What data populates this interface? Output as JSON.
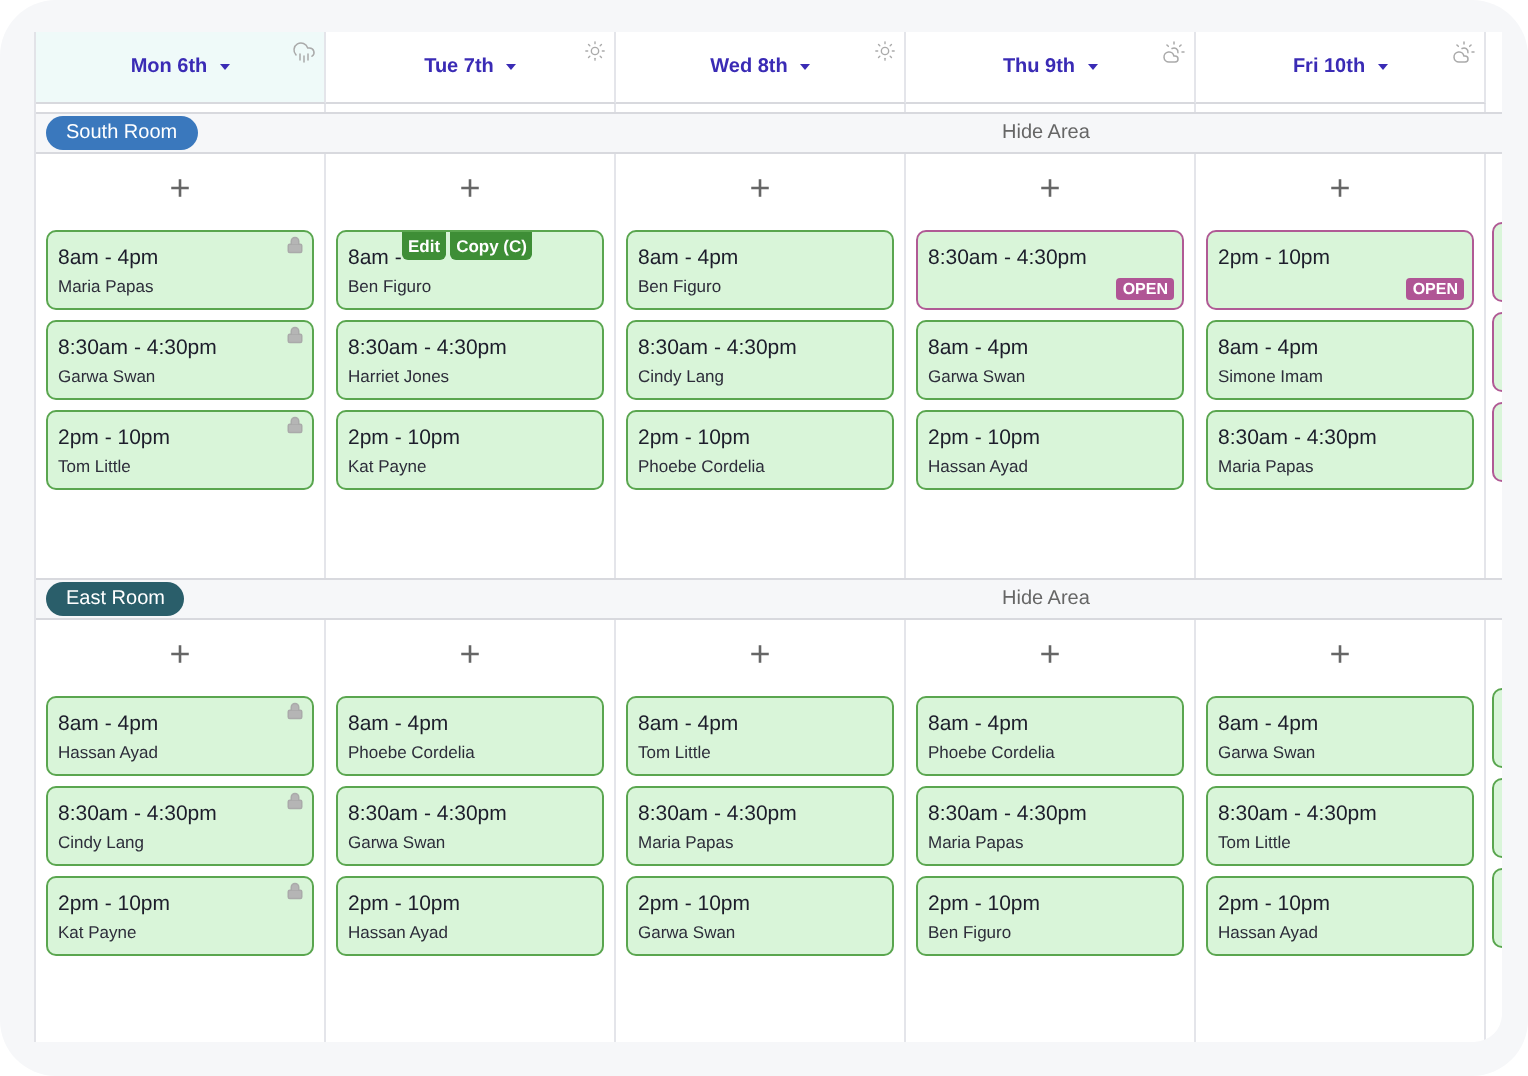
{
  "days": [
    {
      "label": "Mon 6th",
      "selected": true,
      "kind": "rain"
    },
    {
      "label": "Tue 7th",
      "selected": false,
      "kind": "sun"
    },
    {
      "label": "Wed 8th",
      "selected": false,
      "kind": "sun"
    },
    {
      "label": "Thu 9th",
      "selected": false,
      "kind": "partly-cloudy"
    },
    {
      "label": "Fri 10th",
      "selected": false,
      "kind": "partly-cloudy"
    }
  ],
  "rooms": [
    {
      "name": "South Room",
      "color": "#3a78bd",
      "hide_label": "Hide Area",
      "add_label": "+",
      "columns": [
        [
          {
            "time": "8am - 4pm",
            "person": "Maria Papas",
            "locked": true,
            "open": false
          },
          {
            "time": "8:30am - 4:30pm",
            "person": "Garwa Swan",
            "locked": true,
            "open": false
          },
          {
            "time": "2pm - 10pm",
            "person": "Tom Little",
            "locked": true,
            "open": false
          }
        ],
        [
          {
            "time": "8am -",
            "person": "Ben Figuro",
            "locked": false,
            "open": false,
            "actions": [
              "Edit",
              "Copy (C)"
            ]
          },
          {
            "time": "8:30am - 4:30pm",
            "person": "Harriet Jones",
            "locked": false,
            "open": false
          },
          {
            "time": "2pm - 10pm",
            "person": "Kat Payne",
            "locked": false,
            "open": false
          }
        ],
        [
          {
            "time": "8am - 4pm",
            "person": "Ben Figuro",
            "locked": false,
            "open": false
          },
          {
            "time": "8:30am - 4:30pm",
            "person": "Cindy Lang",
            "locked": false,
            "open": false
          },
          {
            "time": "2pm - 10pm",
            "person": "Phoebe Cordelia",
            "locked": false,
            "open": false
          }
        ],
        [
          {
            "time": "8:30am - 4:30pm",
            "locked": false,
            "open": true,
            "badge": "OPEN"
          },
          {
            "time": "8am - 4pm",
            "person": "Garwa Swan",
            "locked": false,
            "open": false
          },
          {
            "time": "2pm - 10pm",
            "person": "Hassan Ayad",
            "locked": false,
            "open": false
          }
        ],
        [
          {
            "time": "2pm - 10pm",
            "locked": false,
            "open": true,
            "badge": "OPEN"
          },
          {
            "time": "8am - 4pm",
            "person": "Simone Imam",
            "locked": false,
            "open": false
          },
          {
            "time": "8:30am - 4:30pm",
            "person": "Maria Papas",
            "locked": false,
            "open": false
          }
        ]
      ],
      "cut_column": [
        {
          "open": true
        },
        {
          "open": true
        },
        {
          "open": true
        }
      ]
    },
    {
      "name": "East Room",
      "color": "#2a5e6a",
      "hide_label": "Hide Area",
      "add_label": "+",
      "columns": [
        [
          {
            "time": "8am - 4pm",
            "person": "Hassan Ayad",
            "locked": true,
            "open": false
          },
          {
            "time": "8:30am - 4:30pm",
            "person": "Cindy Lang",
            "locked": true,
            "open": false
          },
          {
            "time": "2pm - 10pm",
            "person": "Kat Payne",
            "locked": true,
            "open": false
          }
        ],
        [
          {
            "time": "8am - 4pm",
            "person": "Phoebe Cordelia",
            "locked": false,
            "open": false
          },
          {
            "time": "8:30am - 4:30pm",
            "person": "Garwa Swan",
            "locked": false,
            "open": false
          },
          {
            "time": "2pm - 10pm",
            "person": "Hassan Ayad",
            "locked": false,
            "open": false
          }
        ],
        [
          {
            "time": "8am - 4pm",
            "person": "Tom Little",
            "locked": false,
            "open": false
          },
          {
            "time": "8:30am - 4:30pm",
            "person": "Maria Papas",
            "locked": false,
            "open": false
          },
          {
            "time": "2pm - 10pm",
            "person": "Garwa Swan",
            "locked": false,
            "open": false
          }
        ],
        [
          {
            "time": "8am - 4pm",
            "person": "Phoebe Cordelia",
            "locked": false,
            "open": false
          },
          {
            "time": "8:30am - 4:30pm",
            "person": "Maria Papas",
            "locked": false,
            "open": false
          },
          {
            "time": "2pm - 10pm",
            "person": "Ben Figuro",
            "locked": false,
            "open": false
          }
        ],
        [
          {
            "time": "8am - 4pm",
            "person": "Garwa Swan",
            "locked": false,
            "open": false
          },
          {
            "time": "8:30am - 4:30pm",
            "person": "Tom Little",
            "locked": false,
            "open": false
          },
          {
            "time": "2pm - 10pm",
            "person": "Hassan Ayad",
            "locked": false,
            "open": false
          }
        ]
      ],
      "cut_column": [
        {
          "open": false
        },
        {
          "open": false
        },
        {
          "open": false
        }
      ]
    }
  ]
}
